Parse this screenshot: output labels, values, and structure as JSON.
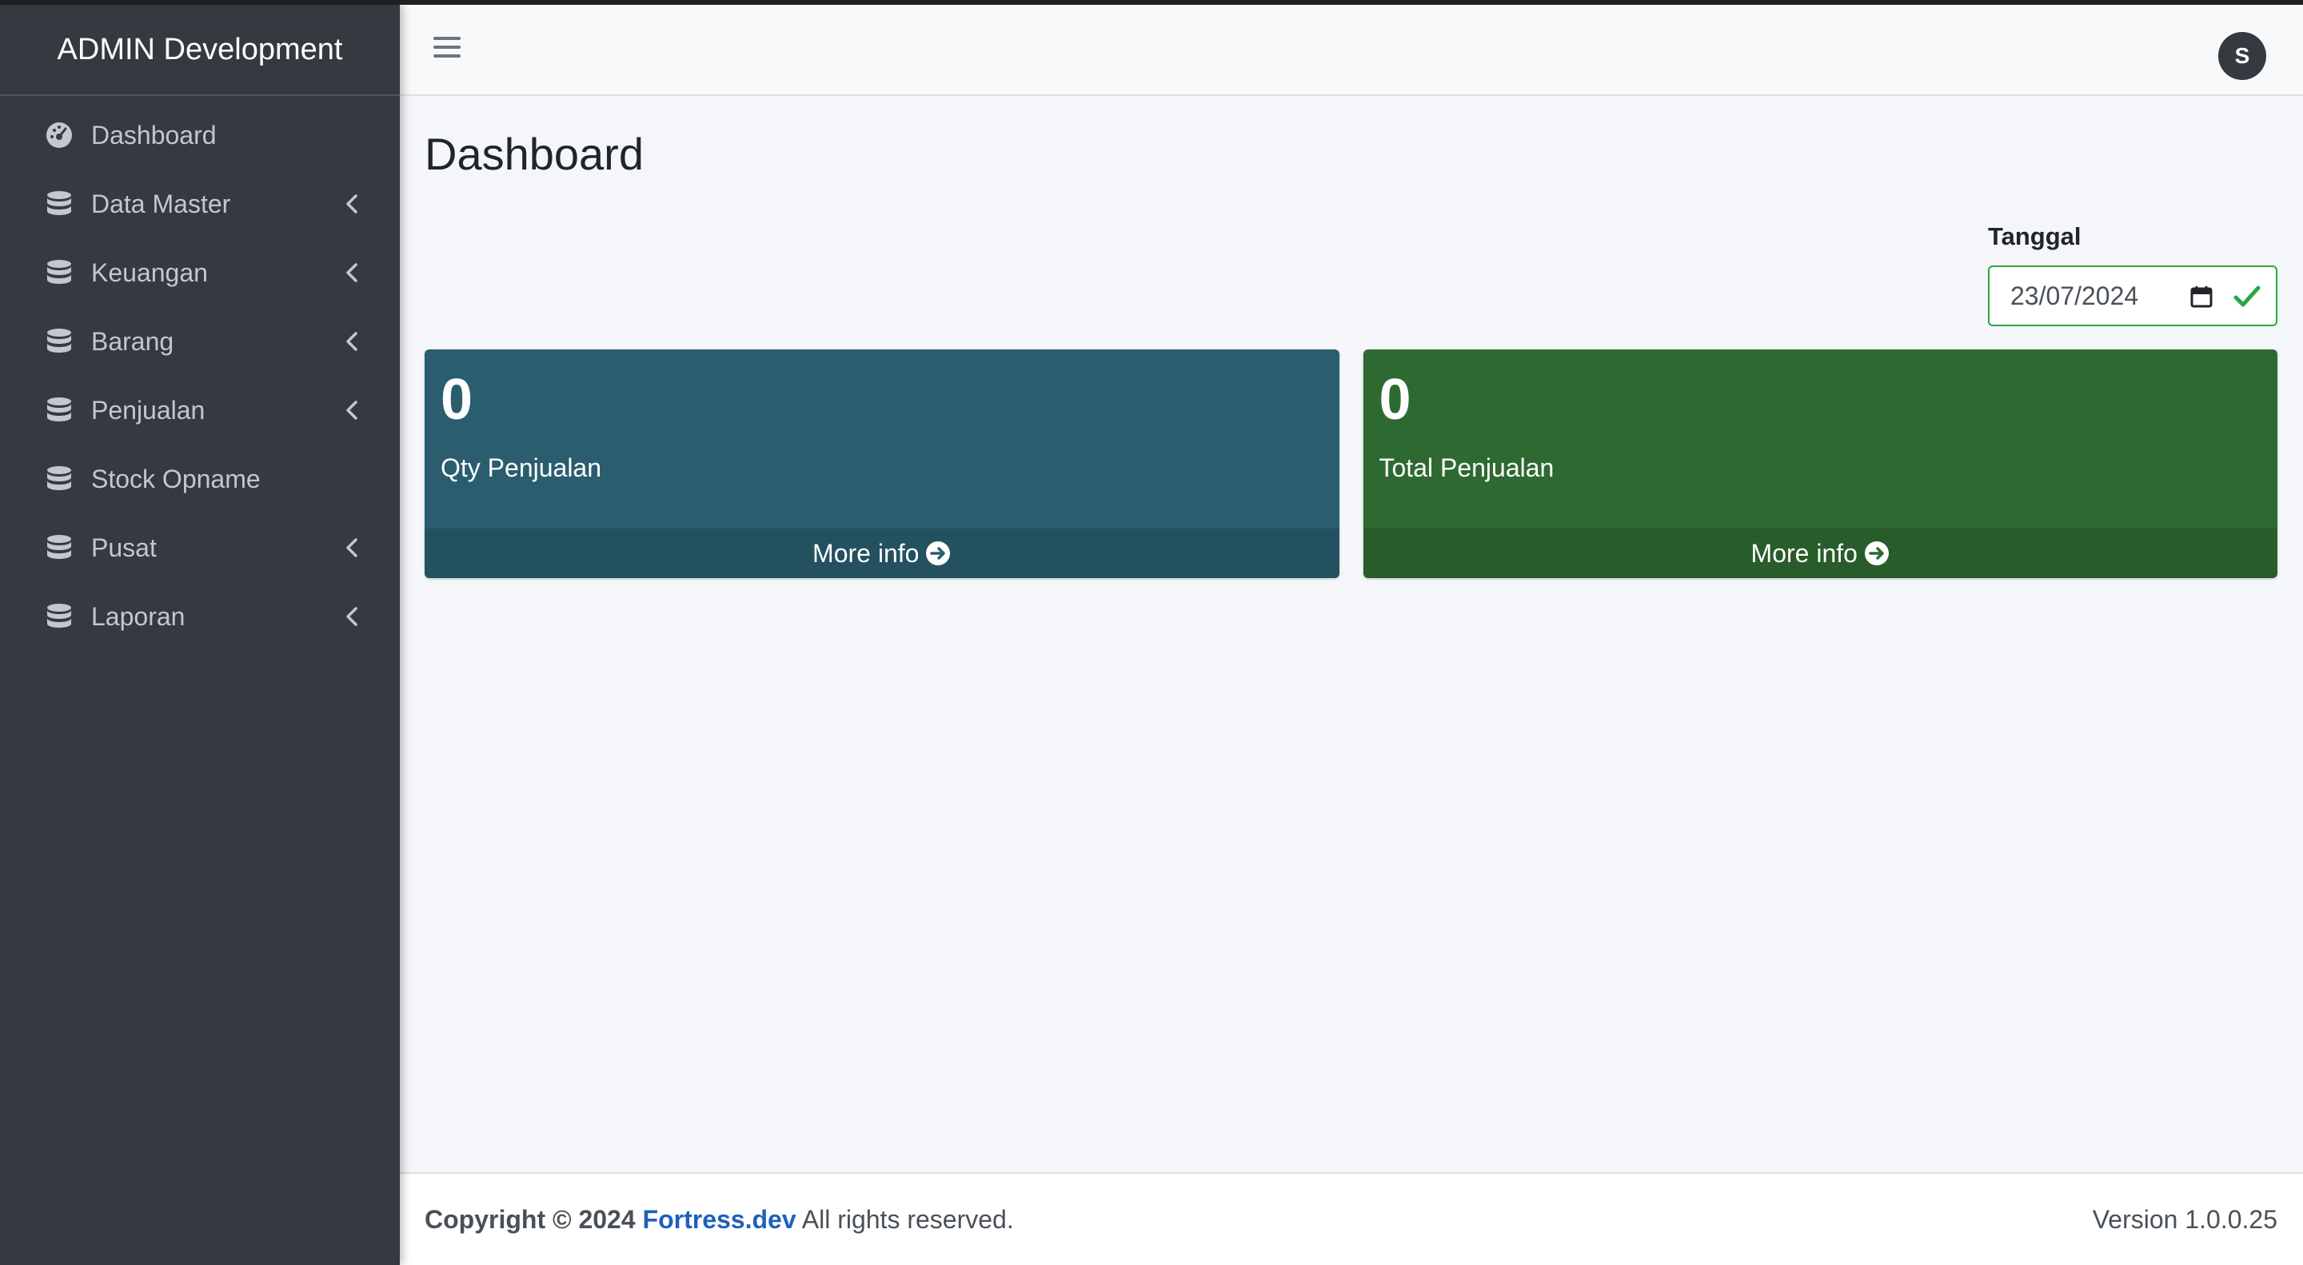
{
  "brand": {
    "title": "ADMIN Development"
  },
  "sidebar": {
    "items": [
      {
        "label": "Dashboard",
        "icon": "tachometer-icon",
        "has_submenu": false
      },
      {
        "label": "Data Master",
        "icon": "database-icon",
        "has_submenu": true
      },
      {
        "label": "Keuangan",
        "icon": "database-icon",
        "has_submenu": true
      },
      {
        "label": "Barang",
        "icon": "database-icon",
        "has_submenu": true
      },
      {
        "label": "Penjualan",
        "icon": "database-icon",
        "has_submenu": true
      },
      {
        "label": "Stock Opname",
        "icon": "database-icon",
        "has_submenu": false
      },
      {
        "label": "Pusat",
        "icon": "database-icon",
        "has_submenu": true
      },
      {
        "label": "Laporan",
        "icon": "database-icon",
        "has_submenu": true
      }
    ]
  },
  "topbar": {
    "avatar_initial": "S"
  },
  "main": {
    "title": "Dashboard",
    "date_filter": {
      "label": "Tanggal",
      "value": "23/07/2024"
    },
    "boxes": [
      {
        "value": "0",
        "label": "Qty Penjualan",
        "footer": "More info",
        "color": "#2a5d6e"
      },
      {
        "value": "0",
        "label": "Total Penjualan",
        "footer": "More info",
        "color": "#2e6931"
      }
    ]
  },
  "footer": {
    "copyright": "Copyright © 2024",
    "link_text": "Fortress.dev",
    "rights": "All rights reserved.",
    "version": "Version 1.0.0.25"
  },
  "colors": {
    "sidebar_bg": "#343a40",
    "success": "#28a745",
    "link": "#1f5fbf"
  }
}
